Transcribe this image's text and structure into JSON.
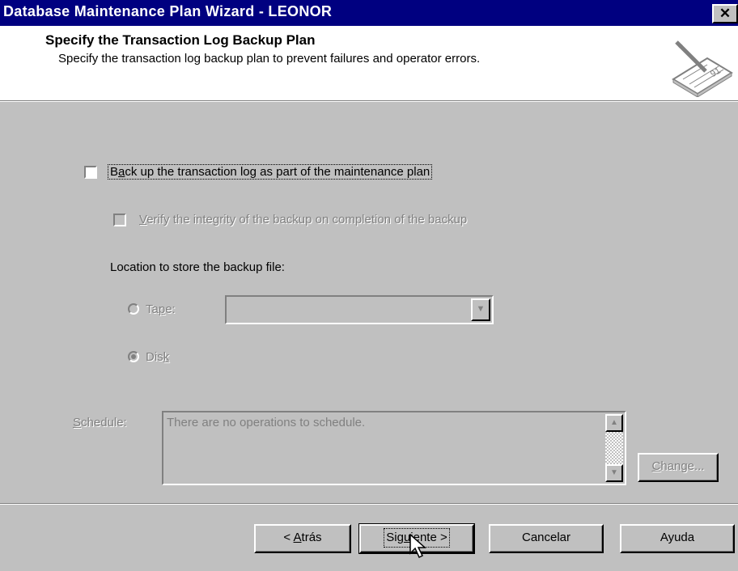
{
  "window": {
    "title": "Database Maintenance Plan Wizard - LEONOR",
    "close_label": "✕"
  },
  "header": {
    "title": "Specify the Transaction Log Backup Plan",
    "subtitle": "Specify the transaction log backup plan to prevent failures and operator errors."
  },
  "options": {
    "backup_log": {
      "pre": "B",
      "accel": "a",
      "post": "ck up the transaction log as part of the maintenance plan",
      "checked": false
    },
    "verify": {
      "pre": "",
      "accel": "V",
      "post": "erify the integrity of the backup on completion of the backup",
      "checked": false
    },
    "location_label": "Location to store the backup file:",
    "tape": {
      "pre": "Ta",
      "accel": "p",
      "post": "e:",
      "selected": false,
      "value": ""
    },
    "disk": {
      "pre": "Dis",
      "accel": "k",
      "post": "",
      "selected": true
    }
  },
  "schedule": {
    "accel": "S",
    "post": "chedule:",
    "text": "There are no operations to schedule."
  },
  "buttons": {
    "change": {
      "accel": "C",
      "post": "hange..."
    },
    "back": {
      "pre": "< ",
      "accel": "A",
      "post": "trás"
    },
    "next": {
      "pre": "Sig",
      "accel": "u",
      "post": "iente >"
    },
    "cancel": "Cancelar",
    "help": "Ayuda"
  }
}
